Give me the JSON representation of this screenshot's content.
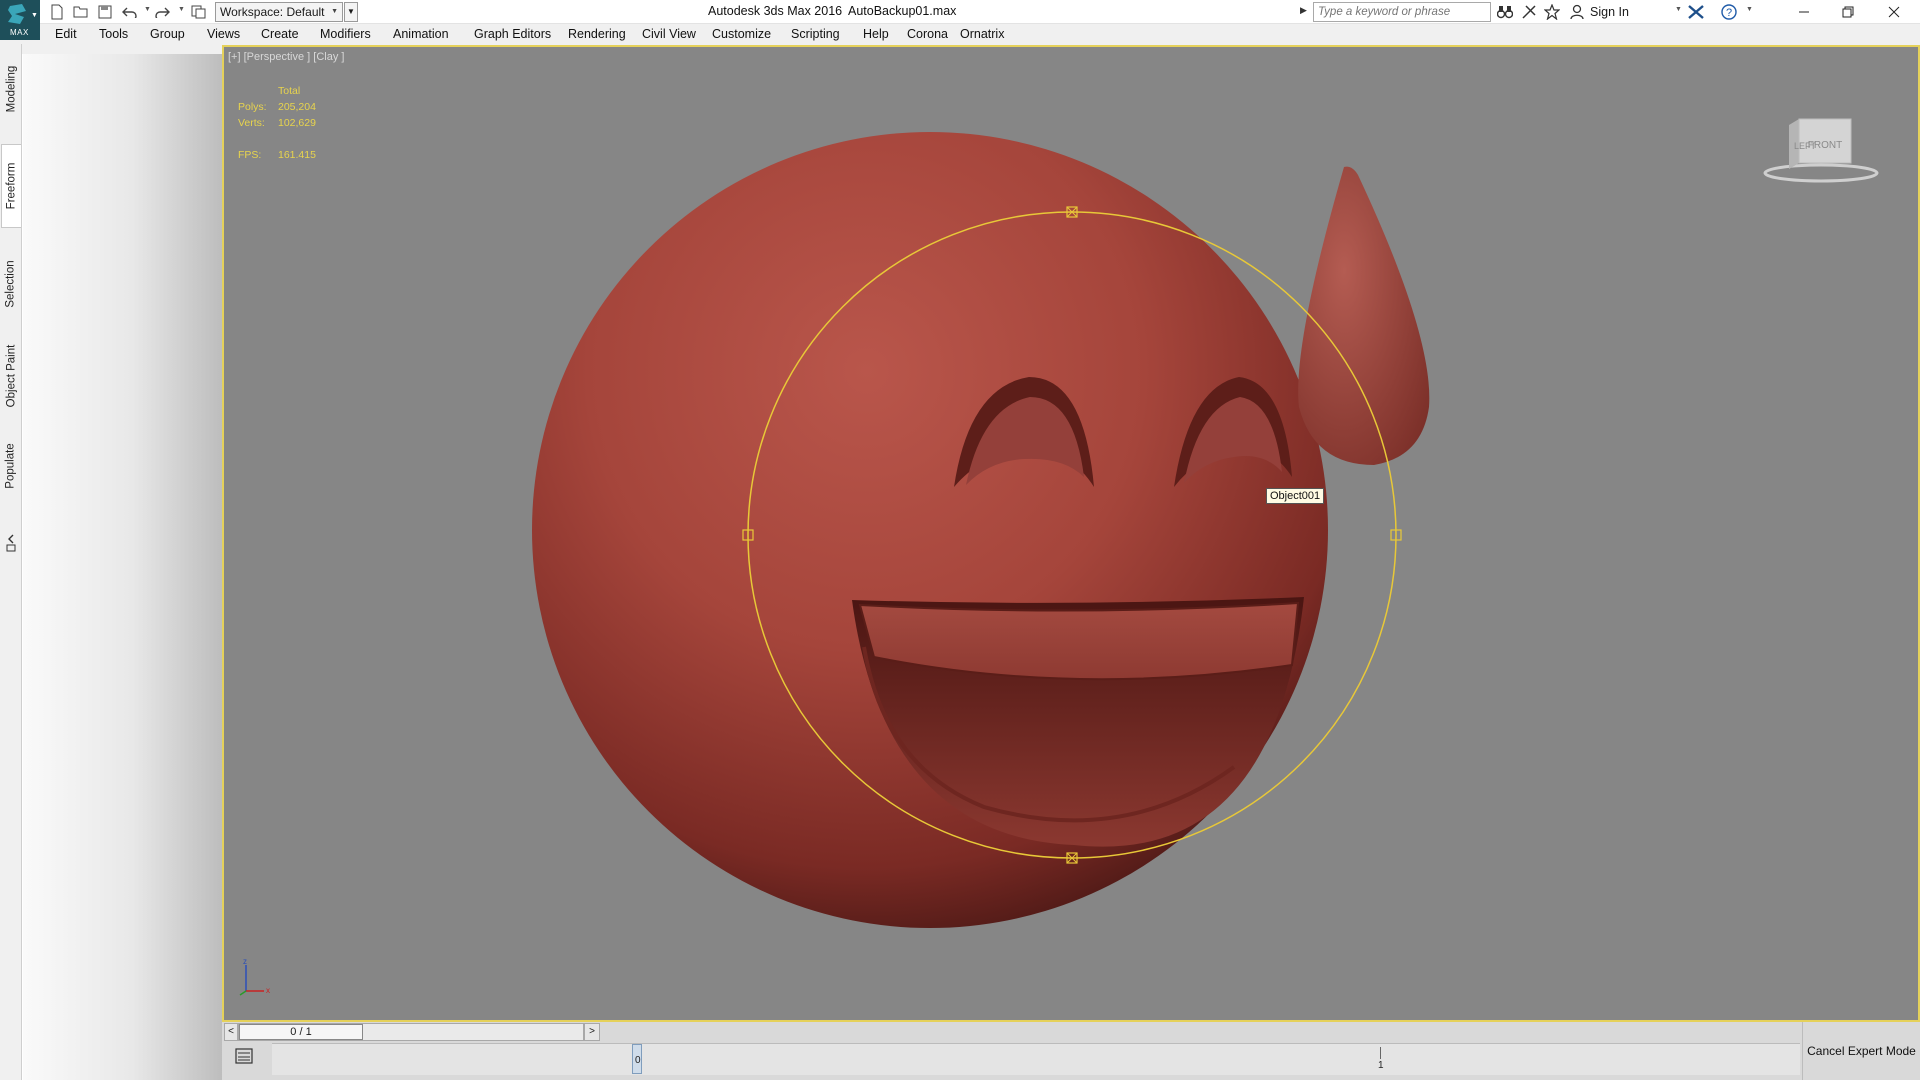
{
  "app": {
    "title": "Autodesk 3ds Max 2016",
    "filename": "AutoBackup01.max",
    "logo_text": "MAX"
  },
  "quick_access": {
    "workspace_label": "Workspace: Default",
    "icons": [
      "new-file-icon",
      "open-file-icon",
      "save-icon",
      "undo-icon",
      "redo-icon",
      "project-folder-icon"
    ]
  },
  "search": {
    "placeholder": "Type a keyword or phrase"
  },
  "info_center": {
    "signin_label": "Sign In",
    "icons": [
      "binoculars-icon",
      "communication-center-icon",
      "favorites-star-icon",
      "user-icon",
      "autodesk-exchange-icon",
      "help-icon"
    ]
  },
  "window_controls": [
    "minimize",
    "restore",
    "close"
  ],
  "menu": {
    "items": [
      "Edit",
      "Tools",
      "Group",
      "Views",
      "Create",
      "Modifiers",
      "Animation",
      "Graph Editors",
      "Rendering",
      "Civil View",
      "Customize",
      "Scripting",
      "Help",
      "Corona",
      "Ornatrix"
    ]
  },
  "ribbon_tabs": {
    "items": [
      "Modeling",
      "Freeform",
      "Selection",
      "Object Paint",
      "Populate"
    ],
    "active": "Freeform"
  },
  "viewport": {
    "label": "[+] [Perspective ] [Clay ]",
    "stats": {
      "header": "Total",
      "polys_label": "Polys:",
      "polys_value": "205,204",
      "verts_label": "Verts:",
      "verts_value": "102,629",
      "fps_label": "FPS:",
      "fps_value": "161.415"
    },
    "viewcube": {
      "left_label": "LEFT",
      "front_label": "FRONT"
    },
    "axis": {
      "z": "z",
      "x": "x"
    },
    "tooltip": "Object001",
    "colors": {
      "background": "#868686",
      "border": "#e5d15a",
      "model": "#a8483e",
      "gizmo": "#e8c838"
    }
  },
  "timebar": {
    "slider_label": "0 / 1",
    "prev": "<",
    "next": ">",
    "frame_start": "0",
    "frame_end": "1"
  },
  "status": {
    "cancel_expert_label": "Cancel Expert Mode"
  }
}
